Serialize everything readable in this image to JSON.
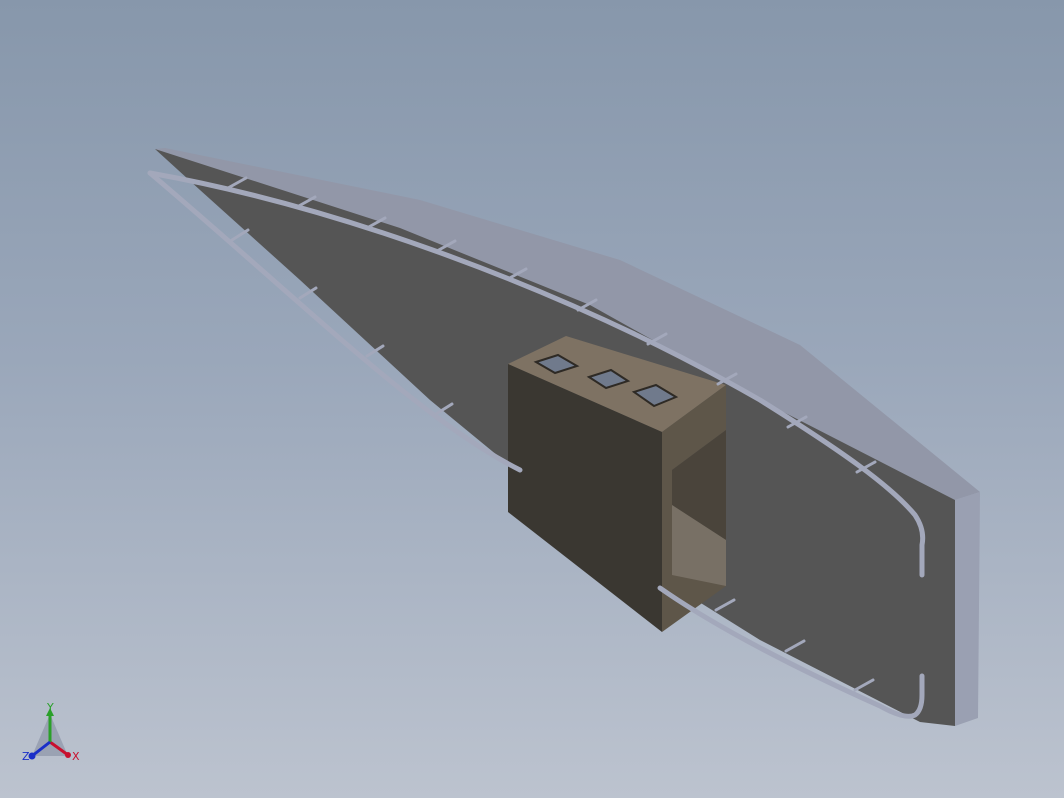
{
  "viewport": {
    "background_top": "#8797ab",
    "background_bottom": "#bcc3cf"
  },
  "model": {
    "panel_face_color": "#555555",
    "panel_edge_color": "#9297a8",
    "wire_color": "#a3a8bb",
    "bracket_front_color": "#3a3731",
    "bracket_top_color": "#7e7263",
    "bracket_side_color": "#5e5649"
  },
  "triad": {
    "x_label": "X",
    "y_label": "Y",
    "z_label": "Z",
    "x_color": "#c8102e",
    "y_color": "#2aa02a",
    "z_color": "#1a2fc8",
    "icon": "axis-triad-icon"
  }
}
